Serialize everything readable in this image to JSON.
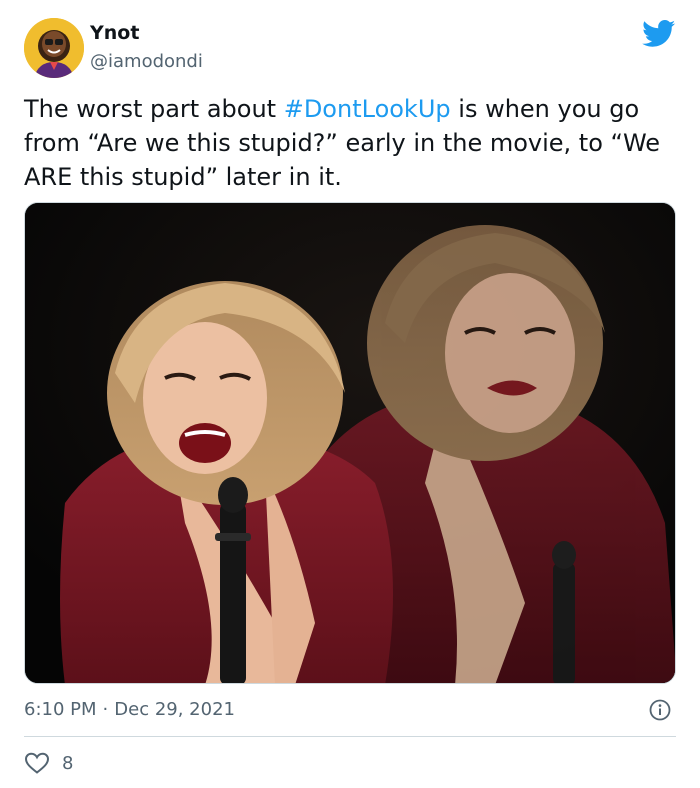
{
  "author": {
    "display_name": "Ynot",
    "handle": "@iamodondi"
  },
  "tweet": {
    "text_before": "The worst part about ",
    "hashtag": "#DontLookUp",
    "text_after": " is when you go from “Are we this stupid?” early in the movie, to “We ARE this stupid” later in it."
  },
  "meta": {
    "time": "6:10 PM",
    "separator": "·",
    "date": "Dec 29, 2021"
  },
  "actions": {
    "like_count": "8"
  },
  "colors": {
    "accent": "#1d9bf0",
    "secondary_text": "#536471",
    "primary_text": "#0f1419",
    "border": "#cfd9de"
  },
  "icons": {
    "brand": "twitter-bird-icon",
    "info": "info-icon",
    "like": "heart-icon"
  }
}
